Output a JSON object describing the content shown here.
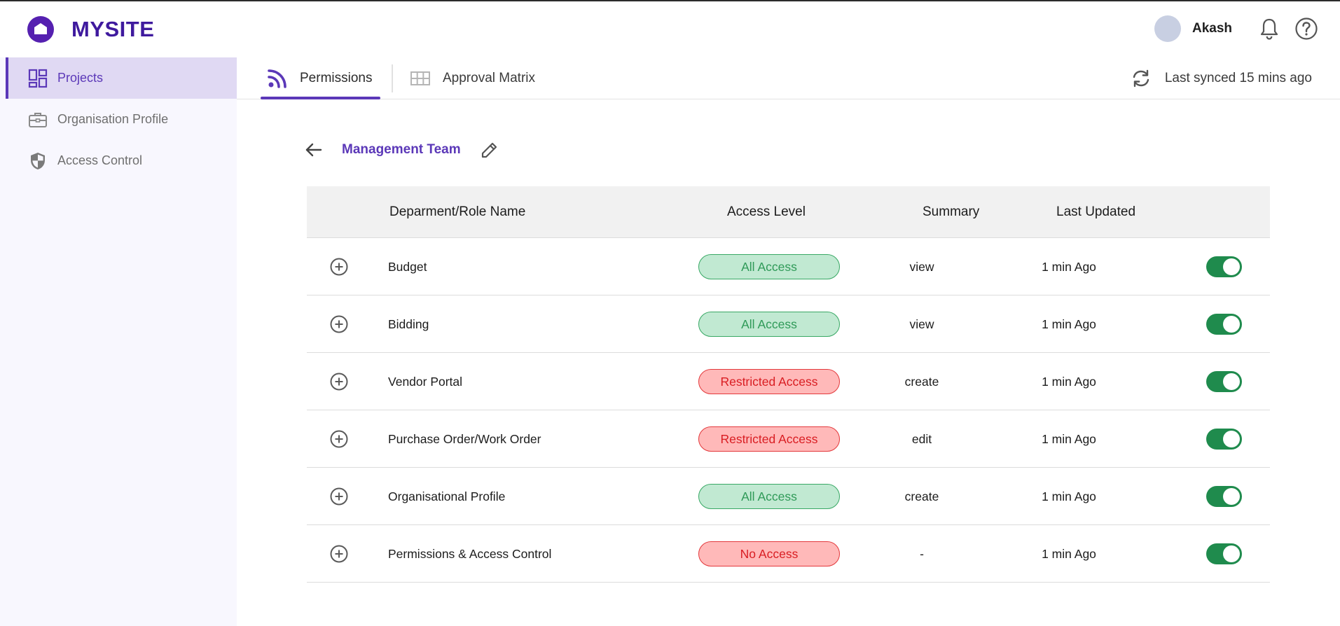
{
  "brand": {
    "name": "MYSITE",
    "color": "#3f1a9e"
  },
  "header": {
    "user_name": "Akash",
    "icons": [
      "bell-icon",
      "help-icon"
    ]
  },
  "sidebar": {
    "items": [
      {
        "label": "Projects",
        "icon": "dashboard-icon",
        "active": true
      },
      {
        "label": "Organisation Profile",
        "icon": "briefcase-icon",
        "active": false
      },
      {
        "label": "Access Control",
        "icon": "shield-icon",
        "active": false
      }
    ]
  },
  "tabs": [
    {
      "label": "Permissions",
      "icon": "rss-icon",
      "active": true
    },
    {
      "label": "Approval Matrix",
      "icon": "grid-icon",
      "active": false
    }
  ],
  "sync": {
    "label": "Last synced 15 mins ago",
    "icon": "sync-icon"
  },
  "page": {
    "team_name": "Management Team"
  },
  "table": {
    "headers": {
      "name": "Deparment/Role Name",
      "access": "Access Level",
      "summary": "Summary",
      "updated": "Last Updated"
    },
    "rows": [
      {
        "name": "Budget",
        "access": "All Access",
        "access_type": "green",
        "summary": "view",
        "updated": "1 min Ago",
        "enabled": true
      },
      {
        "name": "Bidding",
        "access": "All Access",
        "access_type": "green",
        "summary": "view",
        "updated": "1 min Ago",
        "enabled": true
      },
      {
        "name": "Vendor Portal",
        "access": "Restricted Access",
        "access_type": "red",
        "summary": "create",
        "updated": "1 min Ago",
        "enabled": true
      },
      {
        "name": "Purchase Order/Work Order",
        "access": "Restricted Access",
        "access_type": "red",
        "summary": "edit",
        "updated": "1 min Ago",
        "enabled": true
      },
      {
        "name": "Organisational Profile",
        "access": "All Access",
        "access_type": "green",
        "summary": "create",
        "updated": "1 min Ago",
        "enabled": true
      },
      {
        "name": "Permissions & Access Control",
        "access": "No Access",
        "access_type": "red",
        "summary": "-",
        "updated": "1 min Ago",
        "enabled": true
      }
    ]
  },
  "colors": {
    "accent": "#5b38b8",
    "toggle_on": "#1f8b4d",
    "green_badge": "#c1e9d2",
    "red_badge": "#ffb9b9"
  }
}
